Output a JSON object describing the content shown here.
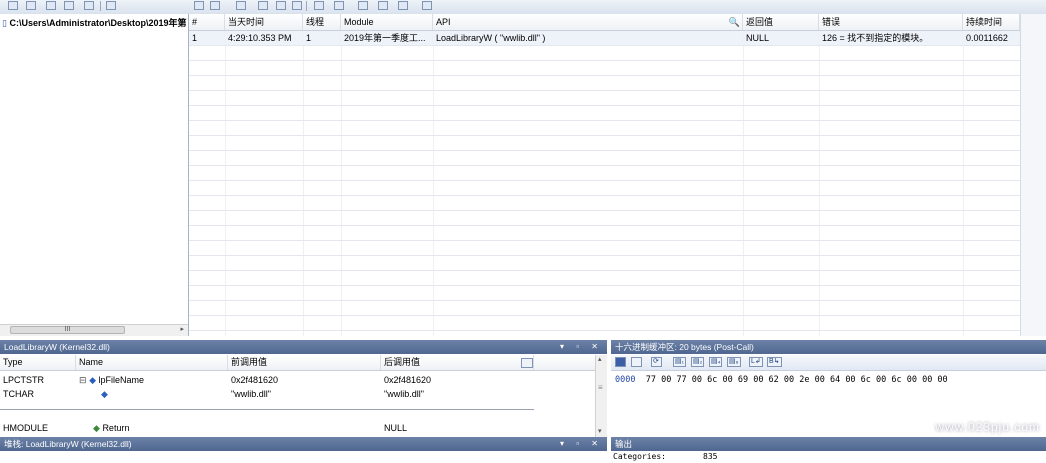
{
  "tree": {
    "root_path": "C:\\Users\\Administrator\\Desktop\\2019年第",
    "scroll_thumb_label": "III"
  },
  "grid": {
    "columns": [
      "#",
      "当天时间",
      "线程",
      "Module",
      "API",
      "返回值",
      "错误",
      "持续时间"
    ],
    "rows": [
      {
        "num": "1",
        "time": "4:29:10.353 PM",
        "thread": "1",
        "module": "2019年第一季度工...",
        "api": "LoadLibraryW ( \"wwlib.dll\" )",
        "return": "NULL",
        "error": "126 = 找不到指定的模块。",
        "duration": "0.0011662"
      }
    ]
  },
  "params_pane": {
    "title": "LoadLibraryW (Kernel32.dll)",
    "columns": [
      "Type",
      "Name",
      "前调用值",
      "后调用值"
    ],
    "rows": [
      {
        "type": "LPCTSTR",
        "name": "lpFileName",
        "pre": "0x2f481620",
        "post": "0x2f481620"
      },
      {
        "type": "TCHAR",
        "name": "",
        "pre": "\"wwlib.dll\"",
        "post": "\"wwlib.dll\""
      },
      {
        "type": "HMODULE",
        "name": "Return",
        "pre": "",
        "post": "NULL"
      }
    ]
  },
  "hex_pane": {
    "title": "十六进制缓冲区: 20 bytes (Post-Call)",
    "address": "0000",
    "bytes": "77 00 77 00 6c 00 69 00 62 00 2e 00 64 00 6c 00 6c 00 00 00"
  },
  "stack_pane": {
    "title": "堆栈: LoadLibraryW (Kernel32.dll)"
  },
  "output_pane": {
    "title": "输出",
    "line_label": "Categories:",
    "line_value": "835"
  },
  "watermark": "www.023pju.com",
  "icons": [
    "save-icon",
    "copy-icon",
    "refresh-icon",
    "view-toggle-icon",
    "search-icon",
    "expand-icon",
    "param-icon"
  ]
}
